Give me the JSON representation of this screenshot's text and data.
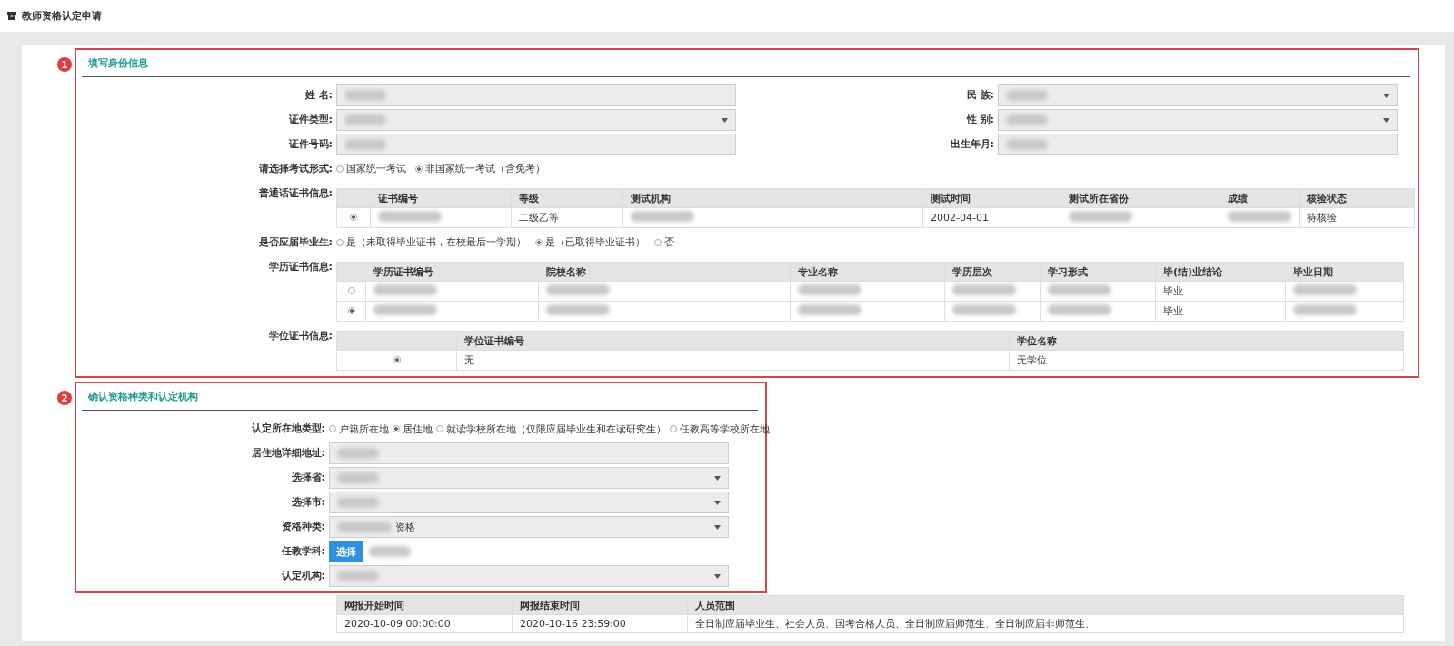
{
  "page_title": "教师资格认定申请",
  "sections": [
    {
      "number": "1",
      "title": "填写身份信息",
      "parts": [
        {
          "kind": "pair",
          "left": {
            "label": "姓 名:",
            "kind": "text",
            "blurred": true
          },
          "right": {
            "label": "民 族:",
            "kind": "select",
            "blurred": true
          }
        },
        {
          "kind": "pair",
          "left": {
            "label": "证件类型:",
            "kind": "select",
            "blurred": true
          },
          "right": {
            "label": "性 别:",
            "kind": "select",
            "blurred": true
          }
        },
        {
          "kind": "pair",
          "left": {
            "label": "证件号码:",
            "kind": "text",
            "blurred": true
          },
          "right": {
            "label": "出生年月:",
            "kind": "text",
            "blurred": true
          }
        },
        {
          "kind": "radios",
          "label": "请选择考试形式:",
          "options": [
            {
              "label": "国家统一考试",
              "selected": false
            },
            {
              "label": "非国家统一考试（含免考）",
              "selected": true
            }
          ]
        },
        {
          "kind": "table",
          "label": "普通话证书信息:",
          "columns": [
            "证书编号",
            "等级",
            "测试机构",
            "测试时间",
            "测试所在省份",
            "成绩",
            "核验状态"
          ],
          "rows": [
            {
              "selected": true,
              "cells": [
                {
                  "blurred": true
                },
                {
                  "text": "二级乙等"
                },
                {
                  "blurred": true
                },
                {
                  "text": "2002-04-01"
                },
                {
                  "blurred": true
                },
                {
                  "blurred": true
                },
                {
                  "text": "待核验"
                }
              ]
            }
          ]
        },
        {
          "kind": "radios",
          "label": "是否应届毕业生:",
          "options": [
            {
              "label": "是（未取得毕业证书，在校最后一学期）",
              "selected": false
            },
            {
              "label": "是（已取得毕业证书）",
              "selected": true
            },
            {
              "label": "否",
              "selected": false
            }
          ]
        },
        {
          "kind": "table",
          "label": "学历证书信息:",
          "columns": [
            "学历证书编号",
            "院校名称",
            "专业名称",
            "学历层次",
            "学习形式",
            "毕(结)业结论",
            "毕业日期"
          ],
          "rows": [
            {
              "selected": false,
              "cells": [
                {
                  "blurred": true
                },
                {
                  "blurred": true
                },
                {
                  "blurred": true
                },
                {
                  "blurred": true
                },
                {
                  "blurred": true
                },
                {
                  "text": "毕业"
                },
                {
                  "blurred": true
                }
              ]
            },
            {
              "selected": true,
              "cells": [
                {
                  "blurred": true
                },
                {
                  "blurred": true
                },
                {
                  "blurred": true
                },
                {
                  "blurred": true
                },
                {
                  "blurred": true
                },
                {
                  "text": "毕业"
                },
                {
                  "blurred": true
                }
              ]
            }
          ]
        },
        {
          "kind": "table",
          "label": "学位证书信息:",
          "columns": [
            "学位证书编号",
            "学位名称"
          ],
          "rows": [
            {
              "selected": true,
              "cells": [
                {
                  "text": "无"
                },
                {
                  "text": "无学位"
                }
              ]
            }
          ]
        }
      ]
    },
    {
      "number": "2",
      "title": "确认资格种类和认定机构",
      "parts": [
        {
          "kind": "radios",
          "label": "认定所在地类型:",
          "options": [
            {
              "label": "户籍所在地",
              "selected": false
            },
            {
              "label": "居住地",
              "selected": true
            },
            {
              "label": "就读学校所在地（仅限应届毕业生和在读研究生）",
              "selected": false
            },
            {
              "label": "任教高等学校所在地",
              "selected": false
            }
          ]
        },
        {
          "kind": "field",
          "field": {
            "label": "居住地详细地址:",
            "kind": "text",
            "blurred": true
          }
        },
        {
          "kind": "field",
          "field": {
            "label": "选择省:",
            "kind": "select",
            "blurred": true
          }
        },
        {
          "kind": "field",
          "field": {
            "label": "选择市:",
            "kind": "select",
            "blurred": true
          }
        },
        {
          "kind": "field",
          "field": {
            "label": "资格种类:",
            "kind": "select",
            "blurred": true,
            "value": "资格"
          }
        },
        {
          "kind": "field",
          "field": {
            "label": "任教学科:",
            "kind": "button",
            "button": "选择",
            "blurred": true
          }
        },
        {
          "kind": "field",
          "field": {
            "label": "认定机构:",
            "kind": "select",
            "blurred": true
          }
        }
      ]
    }
  ],
  "period_table": {
    "columns": [
      "网报开始时间",
      "网报结束时间",
      "人员范围"
    ],
    "rows": [
      {
        "cells": [
          "2020-10-09 00:00:00",
          "2020-10-16 23:59:00",
          "全日制应届毕业生、社会人员、国考合格人员、全日制应届师范生、全日制应届非师范生、"
        ]
      }
    ]
  }
}
